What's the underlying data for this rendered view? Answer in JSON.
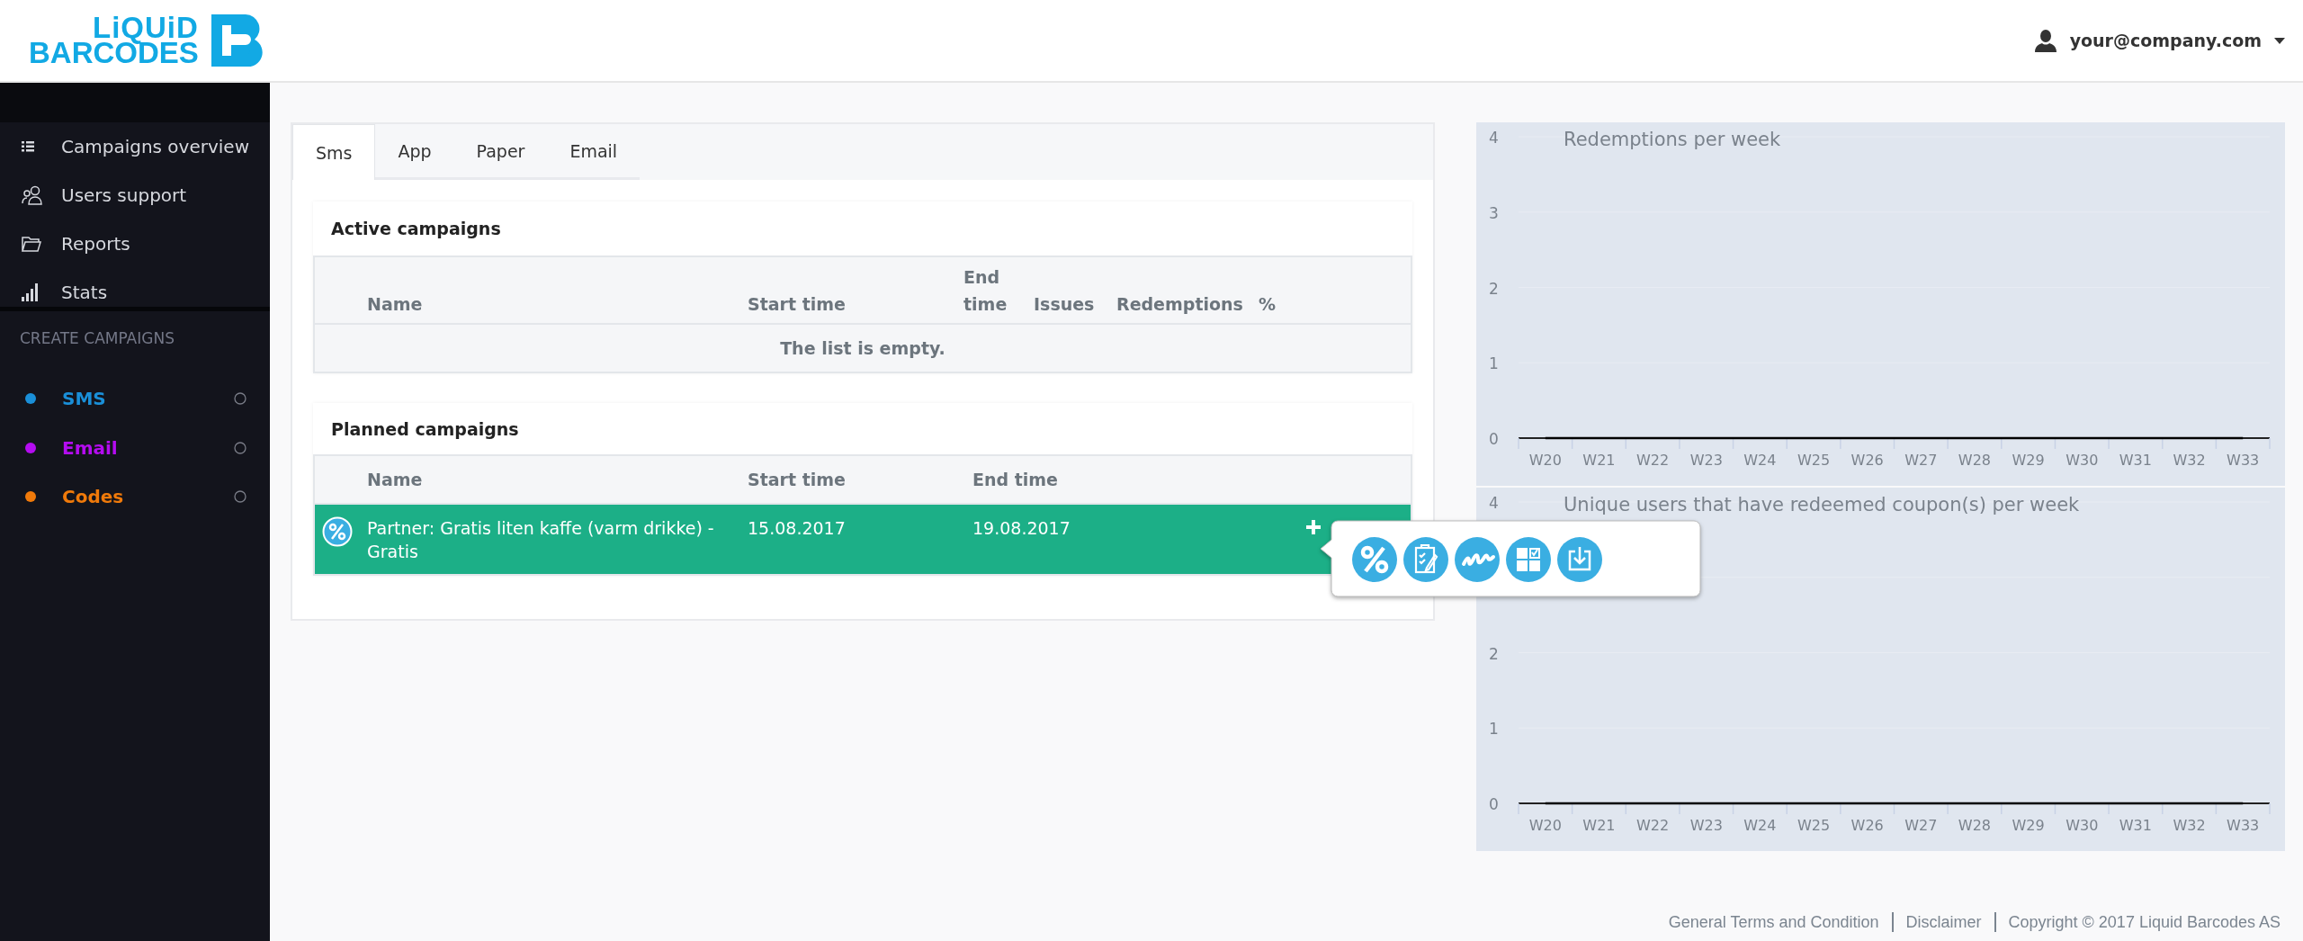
{
  "header": {
    "logo": {
      "line1": "LiQUiD",
      "line2": "BARCODES"
    },
    "user": "your@company.com"
  },
  "sidebar": {
    "items": [
      {
        "label": "Campaigns overview",
        "selected": false
      },
      {
        "label": "Users support",
        "selected": false
      },
      {
        "label": "Reports",
        "selected": false
      },
      {
        "label": "Stats",
        "selected": false
      }
    ],
    "section_title": "CREATE CAMPAIGNS",
    "create_items": [
      {
        "label": "SMS",
        "color": "#1a8fd8"
      },
      {
        "label": "Email",
        "color": "#b40cf0"
      },
      {
        "label": "Codes",
        "color": "#f07a0a"
      }
    ]
  },
  "tabs": [
    {
      "label": "Sms",
      "selected": true
    },
    {
      "label": "App",
      "selected": false
    },
    {
      "label": "Paper",
      "selected": false
    },
    {
      "label": "Email",
      "selected": false
    }
  ],
  "active_campaigns": {
    "title": "Active campaigns",
    "columns": [
      "Name",
      "Start time",
      "End time",
      "Issues",
      "Redemptions",
      "%"
    ],
    "empty_text": "The list is empty."
  },
  "planned_campaigns": {
    "title": "Planned campaigns",
    "columns": [
      "Name",
      "Start time",
      "End time"
    ],
    "rows": [
      {
        "name": "Partner: Gratis liten kaffe (varm drikke) - Gratis",
        "start": "15.08.2017",
        "end": "19.08.2017",
        "selected": true,
        "action_menu_open": true
      }
    ]
  },
  "charts": [
    {
      "chart_data": {
        "type": "line",
        "title": "Redemptions per week",
        "categories": [
          "W20",
          "W21",
          "W22",
          "W23",
          "W24",
          "W25",
          "W26",
          "W27",
          "W28",
          "W29",
          "W30",
          "W31",
          "W32",
          "W33"
        ],
        "series": [
          {
            "color": "#000000",
            "values": [
              0,
              0,
              0,
              0,
              0,
              0,
              0,
              0,
              0,
              0,
              0,
              0,
              0,
              0
            ]
          }
        ],
        "ylim": [
          0,
          4
        ],
        "yticks": [
          0,
          1,
          2,
          3,
          4
        ],
        "grid": true
      }
    },
    {
      "chart_data": {
        "type": "line",
        "title": "Unique users that have redeemed coupon(s) per week",
        "categories": [
          "W20",
          "W21",
          "W22",
          "W23",
          "W24",
          "W25",
          "W26",
          "W27",
          "W28",
          "W29",
          "W30",
          "W31",
          "W32",
          "W33"
        ],
        "series": [
          {
            "color": "#000000",
            "values": [
              0,
              0,
              0,
              0,
              0,
              0,
              0,
              0,
              0,
              0,
              0,
              0,
              0,
              0
            ]
          }
        ],
        "ylim": [
          0,
          4
        ],
        "yticks": [
          0,
          1,
          2,
          4
        ],
        "grid": true
      }
    }
  ],
  "footer": {
    "links": [
      "General Terms and Condition",
      "Disclaimer"
    ],
    "copyright": "Copyright © 2017 Liquid Barcodes AS"
  }
}
